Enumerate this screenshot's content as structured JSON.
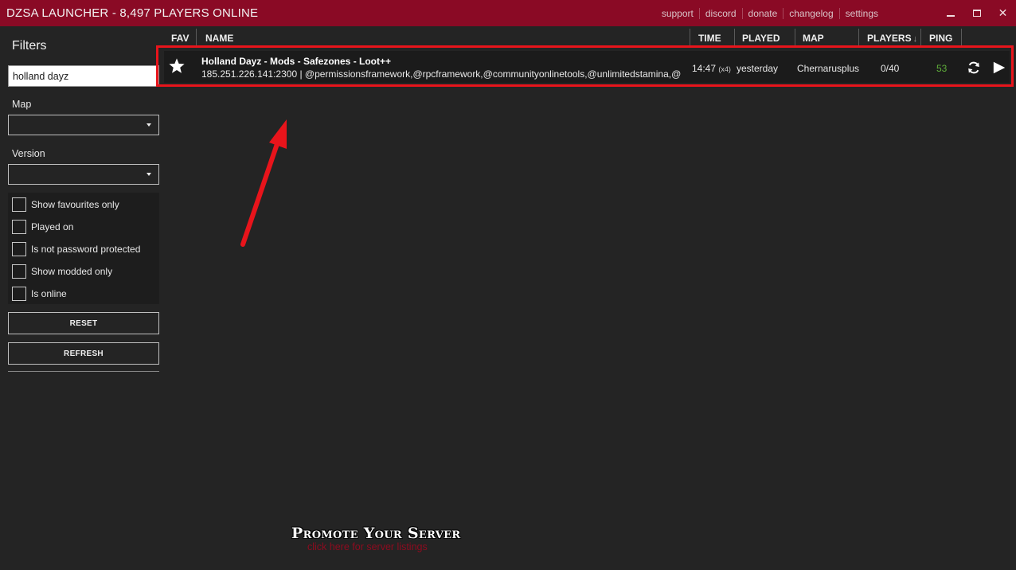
{
  "app": {
    "title": "DZSA LAUNCHER - 8,497 PLAYERS ONLINE",
    "links": [
      "support",
      "discord",
      "donate",
      "changelog",
      "settings"
    ],
    "window_buttons": [
      "minimize-icon",
      "maximize-icon",
      "close-icon"
    ],
    "close_glyph": "✕"
  },
  "colors": {
    "titlebar": "#8a0a25",
    "background": "#242424",
    "row": "#1b1b1b",
    "highlight": "#e8141b",
    "ping_good": "#5fae3a"
  },
  "sidebar": {
    "title": "Filters",
    "search_value": "holland dayz",
    "map_label": "Map",
    "map_value": "",
    "version_label": "Version",
    "version_value": "",
    "checkboxes": [
      {
        "label": "Show favourites only",
        "checked": false
      },
      {
        "label": "Played on",
        "checked": false
      },
      {
        "label": "Is not password protected",
        "checked": false
      },
      {
        "label": "Show modded only",
        "checked": false
      },
      {
        "label": "Is online",
        "checked": false
      }
    ],
    "reset_label": "RESET",
    "refresh_label": "REFRESH"
  },
  "table": {
    "columns": {
      "fav": "FAV",
      "name": "NAME",
      "time": "TIME",
      "played": "PLAYED",
      "map": "MAP",
      "players": "PLAYERS",
      "ping": "PING"
    },
    "sort_indicator": "↓",
    "rows": [
      {
        "favourite": true,
        "name": "Holland Dayz - Mods - Safezones - Loot++",
        "address": "185.251.226.141:2300 | @permissionsframework,@rpcframework,@communityonlinetools,@unlimitedstamina,@kit",
        "time": "14:47",
        "time_mult": "(x4)",
        "played": "yesterday",
        "map": "Chernarusplus",
        "players": "0/40",
        "ping": "53"
      }
    ]
  },
  "promo": {
    "title": "Promote Your Server",
    "subtitle": "click here for server listings"
  }
}
